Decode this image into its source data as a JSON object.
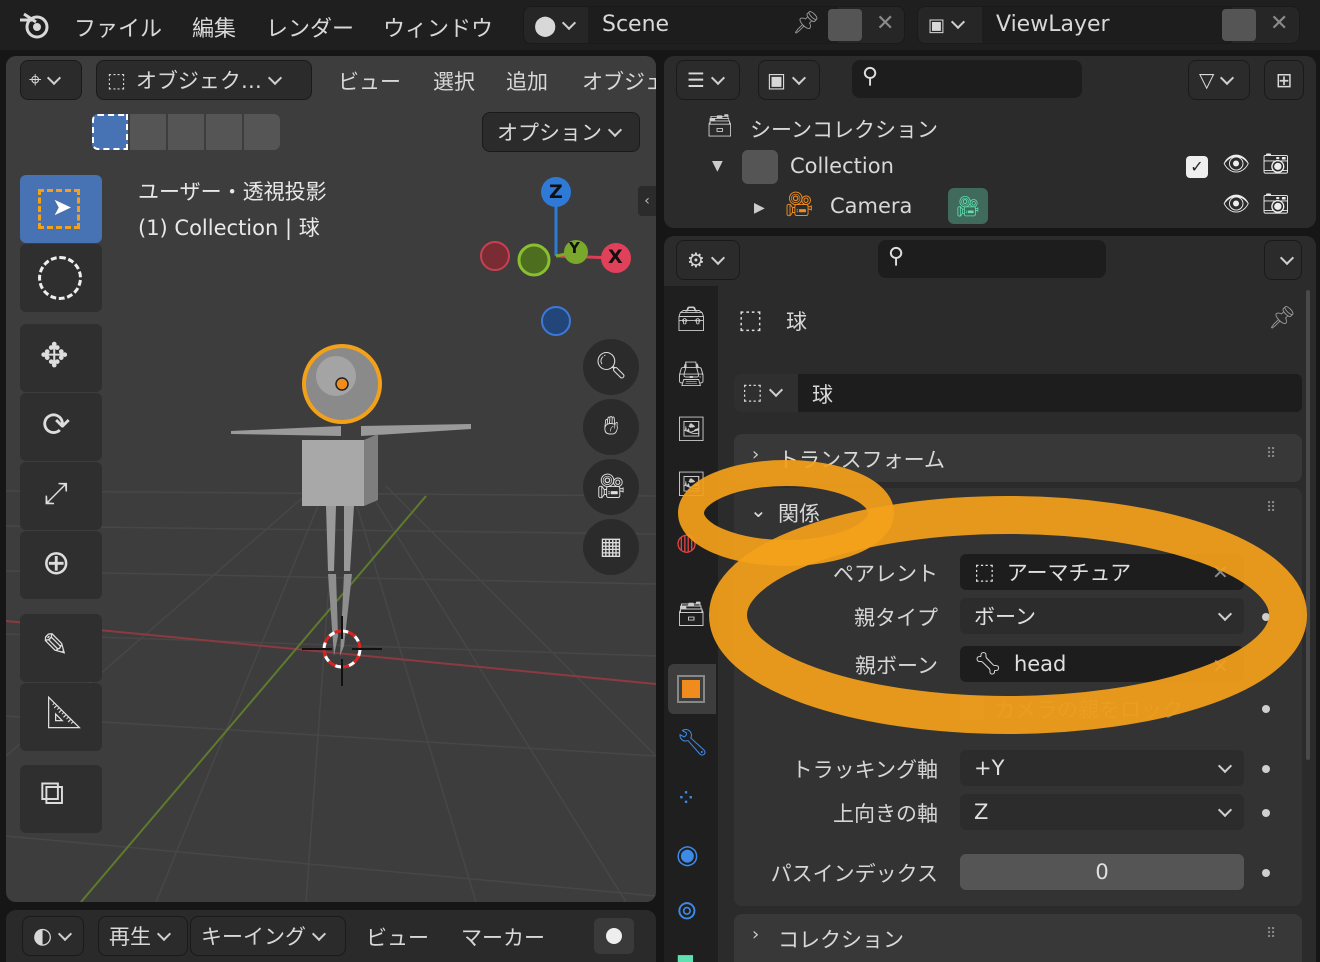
{
  "topbar": {
    "menus": [
      "ファイル",
      "編集",
      "レンダー",
      "ウィンドウ"
    ],
    "scene_name": "Scene",
    "viewlayer_name": "ViewLayer"
  },
  "viewport": {
    "header": {
      "mode_label": "オブジェク…",
      "menus": [
        "ビュー",
        "選択",
        "追加",
        "オブジェ"
      ],
      "options_label": "オプション"
    },
    "overlay": {
      "view_name": "ユーザー・透視投影",
      "collection_info": "(1) Collection | 球"
    },
    "gizmo": {
      "z": "Z",
      "y": "Y",
      "x": "X"
    }
  },
  "timeline": {
    "menus": [
      "再生",
      "キーイング",
      "ビュー",
      "マーカー"
    ]
  },
  "outliner": {
    "root": "シーンコレクション",
    "collection": "Collection",
    "camera": "Camera"
  },
  "properties": {
    "object_name_header": "球",
    "object_name_field": "球",
    "panels": {
      "transform": "トランスフォーム",
      "relations": "関係",
      "collections": "コレクション"
    },
    "relations": {
      "parent_label": "ペアレント",
      "parent_value": "アーマチュア",
      "parent_type_label": "親タイプ",
      "parent_type_value": "ボーン",
      "parent_bone_label": "親ボーン",
      "parent_bone_value": "head",
      "camera_lock_label": "カメラの親をロック",
      "tracking_axis_label": "トラッキング軸",
      "tracking_axis_value": "+Y",
      "up_axis_label": "上向きの軸",
      "up_axis_value": "Z",
      "pass_index_label": "パスインデックス",
      "pass_index_value": "0"
    }
  },
  "colors": {
    "accent_blue": "#4772b3",
    "highlight_orange": "#f4a11a",
    "object_orange": "#f08c1e"
  }
}
